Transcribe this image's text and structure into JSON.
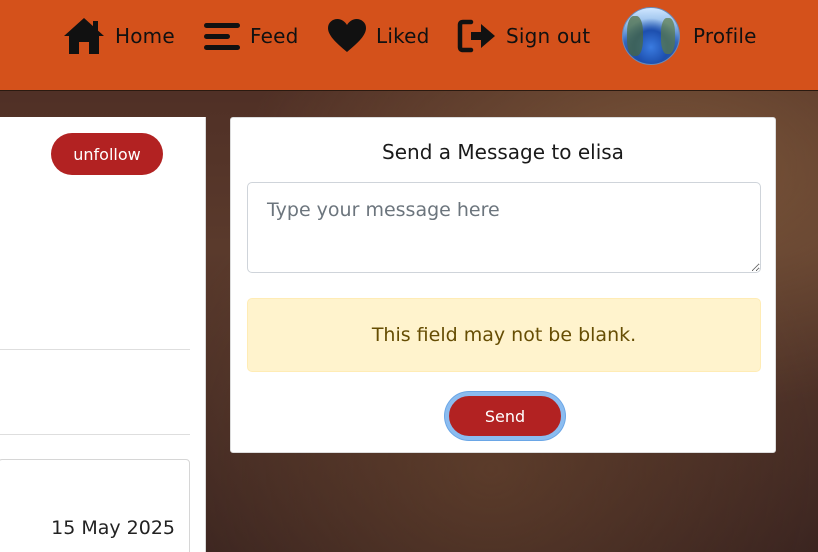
{
  "navbar": {
    "items": [
      {
        "label": "Home",
        "icon": "home-icon"
      },
      {
        "label": "Feed",
        "icon": "menu-icon"
      },
      {
        "label": "Liked",
        "icon": "heart-icon"
      },
      {
        "label": "Sign out",
        "icon": "sign-out-icon"
      },
      {
        "label": "Profile",
        "icon": "avatar"
      }
    ],
    "background_color": "#d4511b"
  },
  "left_panel": {
    "unfollow_label": "unfollow",
    "post_date": "15 May 2025"
  },
  "message_panel": {
    "title": "Send a Message to elisa",
    "input_placeholder": "Type your message here",
    "input_value": "",
    "error_text": "This field may not be blank.",
    "send_label": "Send"
  },
  "colors": {
    "accent": "#b22222",
    "alert_bg": "#fff3cd",
    "alert_text": "#664d03"
  }
}
